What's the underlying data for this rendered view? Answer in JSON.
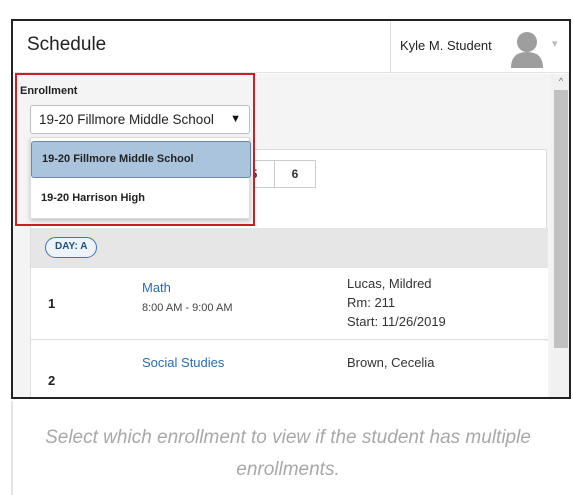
{
  "header": {
    "title": "Schedule",
    "user_name": "Kyle M. Student",
    "user_chevron": "▾"
  },
  "enrollment": {
    "label": "Enrollment",
    "selected": "19-20 Fillmore Middle School",
    "caret": "▼",
    "options": [
      {
        "label": "19-20 Fillmore Middle School",
        "highlighted": true
      },
      {
        "label": "19-20 Harrison High",
        "highlighted": false
      }
    ]
  },
  "term_tabs": [
    "5",
    "6"
  ],
  "day_badge": "DAY: A",
  "periods": [
    {
      "number": "1",
      "course": "Math",
      "time": "8:00 AM - 9:00 AM",
      "teacher": "Lucas, Mildred",
      "room": "Rm: 211",
      "start": "Start: 11/26/2019"
    },
    {
      "number": "2",
      "course": "Social Studies",
      "teacher": "Brown, Cecelia"
    }
  ],
  "scrollbar": {
    "up_arrow": "^"
  },
  "caption": "Select which enrollment to view if the student has multiple enrollments.",
  "colors": {
    "highlight_box": "#c8202a",
    "link": "#2b6cb0",
    "selected_option": "#a9c4dc"
  }
}
